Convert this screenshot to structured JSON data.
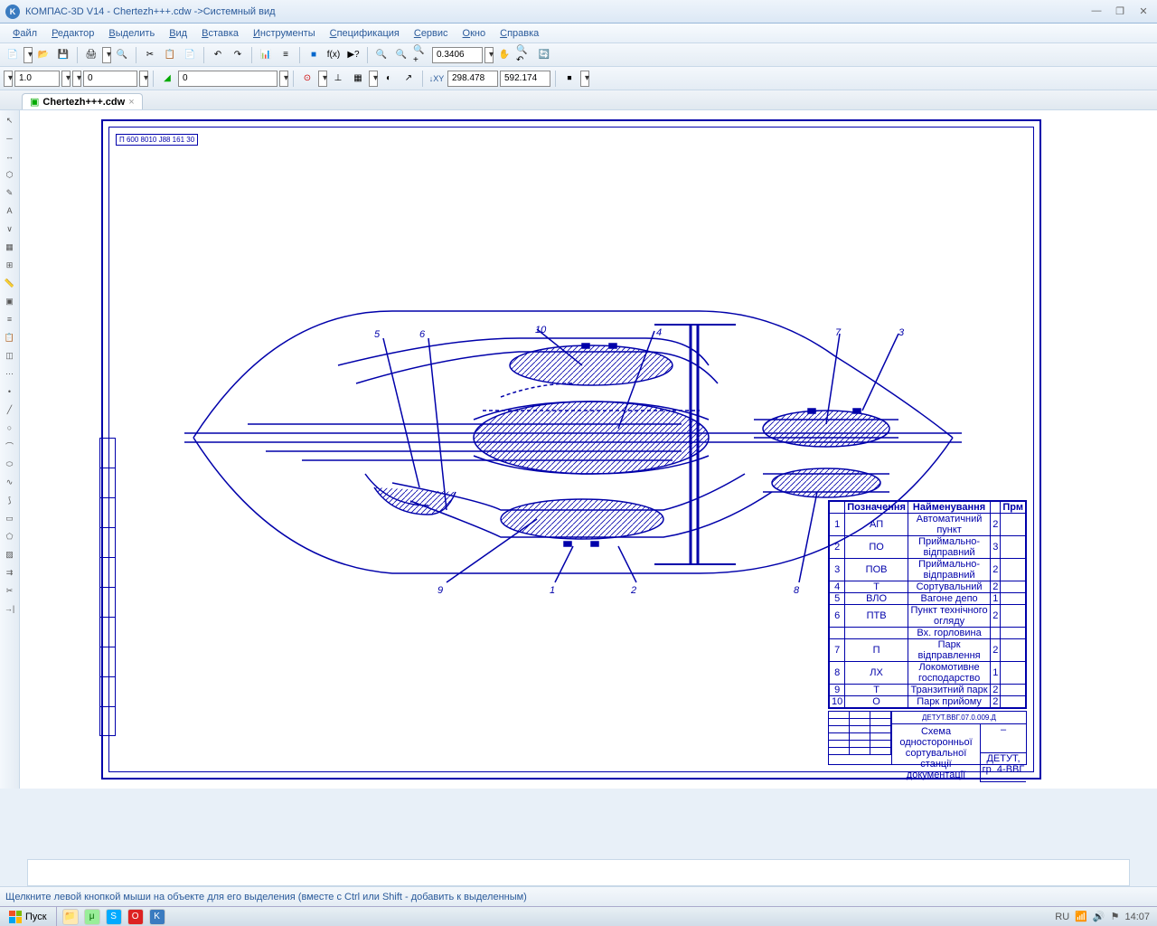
{
  "title": "КОМПАС-3D V14 - Chertezh+++.cdw ->Системный вид",
  "menu": [
    "Файл",
    "Редактор",
    "Выделить",
    "Вид",
    "Вставка",
    "Инструменты",
    "Спецификация",
    "Сервис",
    "Окно",
    "Справка"
  ],
  "toolbar1": {
    "zoom": "0.3406"
  },
  "toolbar2": {
    "scale": "1.0",
    "step": "0",
    "coord": "0",
    "x": "298.478",
    "y": "592.174"
  },
  "doc_tab": "Chertezh+++.cdw",
  "stamp": "П 600 8010 J88 161 30",
  "labels": {
    "l1": "1",
    "l2": "2",
    "l3": "3",
    "l4": "4",
    "l5": "5",
    "l6": "6",
    "l7": "7",
    "l8": "8",
    "l9": "9",
    "l10": "10"
  },
  "spec": {
    "headers": [
      "",
      "Позначення",
      "Найменування",
      "",
      "Прм"
    ],
    "rows": [
      [
        "1",
        "АП",
        "Автоматичний пункт",
        "2",
        ""
      ],
      [
        "2",
        "ПО",
        "Приймально-відправний",
        "3",
        ""
      ],
      [
        "3",
        "ПОВ",
        "Приймально-відправний",
        "2",
        ""
      ],
      [
        "4",
        "Т",
        "Сортувальний",
        "2",
        ""
      ],
      [
        "5",
        "ВЛО",
        "Вагоне депо",
        "1",
        ""
      ],
      [
        "6",
        "ПТВ",
        "Пункт технічного огляду",
        "2",
        ""
      ],
      [
        "",
        "",
        "Вх. горловина",
        "",
        ""
      ],
      [
        "7",
        "П",
        "Парк відправлення",
        "2",
        ""
      ],
      [
        "8",
        "ЛХ",
        "Локомотивне господарство",
        "1",
        ""
      ],
      [
        "9",
        "Т",
        "Транзитний парк",
        "2",
        ""
      ],
      [
        "10",
        "О",
        "Парк прийому",
        "2",
        ""
      ]
    ]
  },
  "title_block": {
    "code": "ДЕТУТ.ВВГ.07.0.009.Д",
    "desc": "Схема односторонньої сортувальної станції документації",
    "org": "ДЕТУТ, гр. 4-ВВГ"
  },
  "status": "Щелкните левой кнопкой мыши на объекте для его выделения (вместе с Ctrl или Shift - добавить к выделенным)",
  "start": "Пуск",
  "clock": "14:07"
}
